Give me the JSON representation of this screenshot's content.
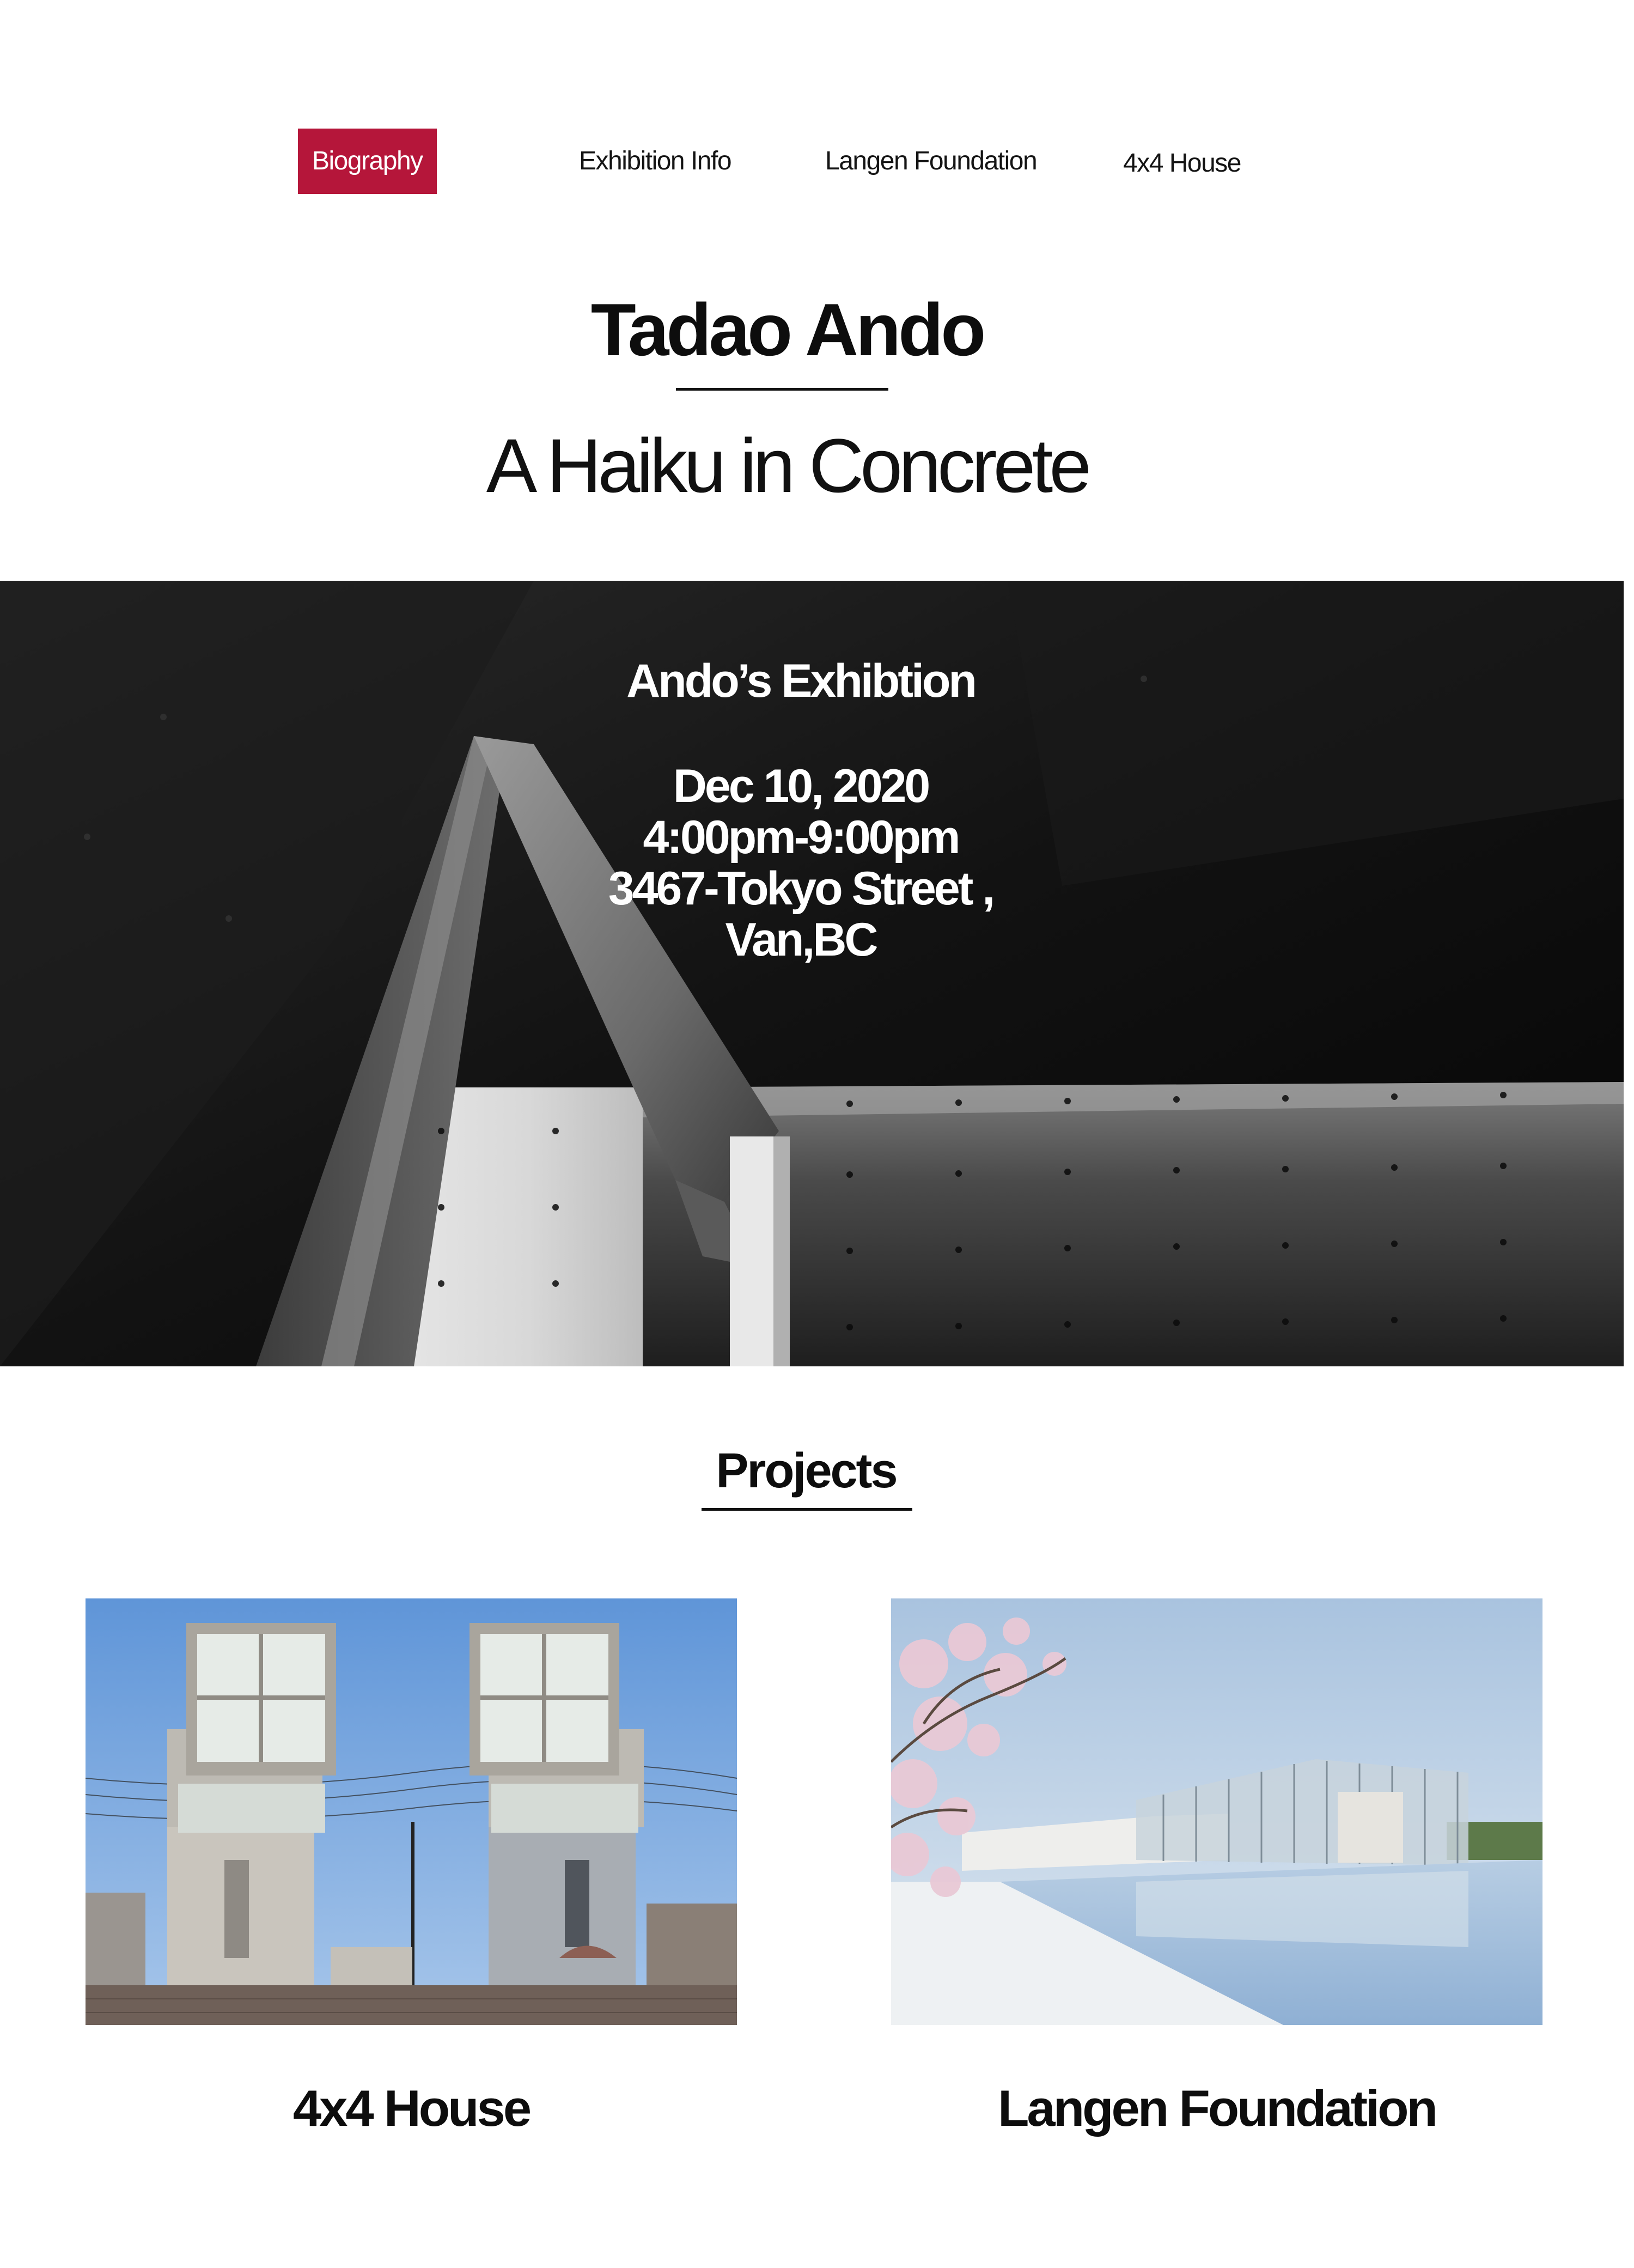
{
  "nav": {
    "items": [
      {
        "label": "Biography",
        "active": true
      },
      {
        "label": "Exhibition Info",
        "active": false
      },
      {
        "label": "Langen Foundation",
        "active": false
      },
      {
        "label": "4x4 House",
        "active": false
      }
    ]
  },
  "header": {
    "title": "Tadao Ando",
    "subtitle": "A Haiku in Concrete"
  },
  "hero": {
    "heading": "Ando’s Exhibtion",
    "date": "Dec 10, 2020",
    "time": "4:00pm-9:00pm",
    "address_line1": "3467-Tokyo Street ,",
    "address_line2": "Van,BC"
  },
  "projects": {
    "heading": "Projects",
    "items": [
      {
        "label": "4x4 House"
      },
      {
        "label": "Langen Foundation"
      }
    ]
  },
  "colors": {
    "accent": "#b5163a",
    "text": "#111111",
    "background": "#ffffff"
  }
}
